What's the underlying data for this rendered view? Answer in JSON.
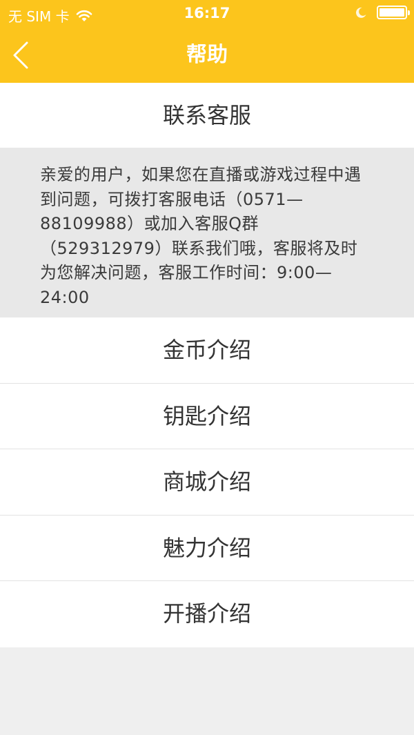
{
  "status_bar": {
    "carrier": "无 SIM 卡",
    "time": "16:17"
  },
  "nav": {
    "title": "帮助",
    "back_icon": "chevron-left-icon"
  },
  "contact": {
    "label": "联系客服"
  },
  "info": {
    "text": "亲爱的用户，如果您在直播或游戏过程中遇到问题，可拨打客服电话（0571—88109988）或加入客服Q群（529312979）联系我们哦，客服将及时为您解决问题，客服工作时间：9:00—24:00"
  },
  "menu": {
    "items": [
      {
        "label": "金币介绍"
      },
      {
        "label": "钥匙介绍"
      },
      {
        "label": "商城介绍"
      },
      {
        "label": "魅力介绍"
      },
      {
        "label": "开播介绍"
      }
    ]
  },
  "colors": {
    "accent": "#fcc51c",
    "background": "#efefef",
    "info_bg": "#e8e8e8",
    "text": "#333333"
  }
}
